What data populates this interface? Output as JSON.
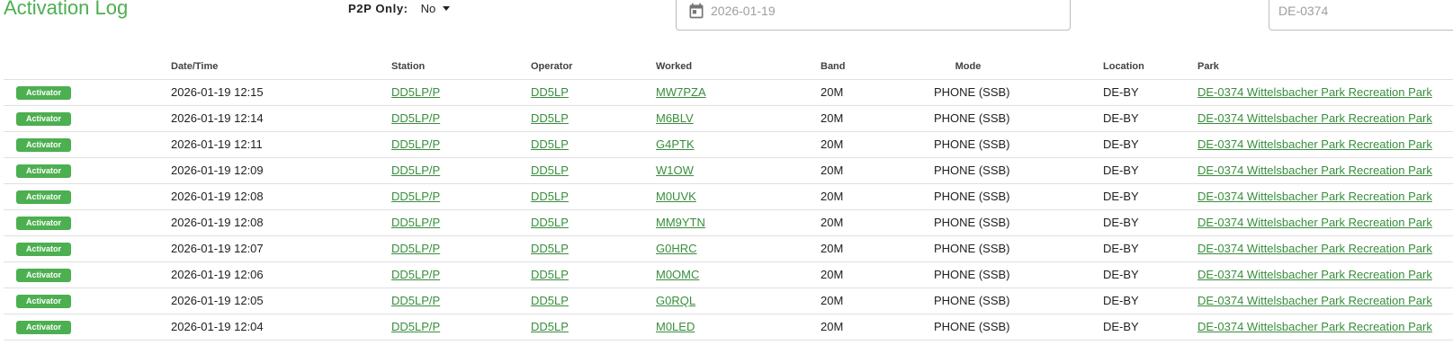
{
  "header": {
    "title": "Activation Log",
    "p2p_label": "P2P Only:",
    "p2p_value": "No",
    "date_placeholder": "2026-01-19",
    "park_placeholder": "DE-0374"
  },
  "table": {
    "columns": [
      "",
      "Date/Time",
      "Station",
      "Operator",
      "Worked",
      "Band",
      "Mode",
      "Location",
      "Park"
    ],
    "rows": [
      {
        "badge": "Activator",
        "datetime": "2026-01-19 12:15",
        "station": "DD5LP/P",
        "operator": "DD5LP",
        "worked": "MW7PZA",
        "band": "20M",
        "mode": "PHONE (SSB)",
        "location": "DE-BY",
        "park": "DE-0374 Wittelsbacher Park Recreation Park"
      },
      {
        "badge": "Activator",
        "datetime": "2026-01-19 12:14",
        "station": "DD5LP/P",
        "operator": "DD5LP",
        "worked": "M6BLV",
        "band": "20M",
        "mode": "PHONE (SSB)",
        "location": "DE-BY",
        "park": "DE-0374 Wittelsbacher Park Recreation Park"
      },
      {
        "badge": "Activator",
        "datetime": "2026-01-19 12:11",
        "station": "DD5LP/P",
        "operator": "DD5LP",
        "worked": "G4PTK",
        "band": "20M",
        "mode": "PHONE (SSB)",
        "location": "DE-BY",
        "park": "DE-0374 Wittelsbacher Park Recreation Park"
      },
      {
        "badge": "Activator",
        "datetime": "2026-01-19 12:09",
        "station": "DD5LP/P",
        "operator": "DD5LP",
        "worked": "W1OW",
        "band": "20M",
        "mode": "PHONE (SSB)",
        "location": "DE-BY",
        "park": "DE-0374 Wittelsbacher Park Recreation Park"
      },
      {
        "badge": "Activator",
        "datetime": "2026-01-19 12:08",
        "station": "DD5LP/P",
        "operator": "DD5LP",
        "worked": "M0UVK",
        "band": "20M",
        "mode": "PHONE (SSB)",
        "location": "DE-BY",
        "park": "DE-0374 Wittelsbacher Park Recreation Park"
      },
      {
        "badge": "Activator",
        "datetime": "2026-01-19 12:08",
        "station": "DD5LP/P",
        "operator": "DD5LP",
        "worked": "MM9YTN",
        "band": "20M",
        "mode": "PHONE (SSB)",
        "location": "DE-BY",
        "park": "DE-0374 Wittelsbacher Park Recreation Park"
      },
      {
        "badge": "Activator",
        "datetime": "2026-01-19 12:07",
        "station": "DD5LP/P",
        "operator": "DD5LP",
        "worked": "G0HRC",
        "band": "20M",
        "mode": "PHONE (SSB)",
        "location": "DE-BY",
        "park": "DE-0374 Wittelsbacher Park Recreation Park"
      },
      {
        "badge": "Activator",
        "datetime": "2026-01-19 12:06",
        "station": "DD5LP/P",
        "operator": "DD5LP",
        "worked": "M0OMC",
        "band": "20M",
        "mode": "PHONE (SSB)",
        "location": "DE-BY",
        "park": "DE-0374 Wittelsbacher Park Recreation Park"
      },
      {
        "badge": "Activator",
        "datetime": "2026-01-19 12:05",
        "station": "DD5LP/P",
        "operator": "DD5LP",
        "worked": "G0RQL",
        "band": "20M",
        "mode": "PHONE (SSB)",
        "location": "DE-BY",
        "park": "DE-0374 Wittelsbacher Park Recreation Park"
      },
      {
        "badge": "Activator",
        "datetime": "2026-01-19 12:04",
        "station": "DD5LP/P",
        "operator": "DD5LP",
        "worked": "M0LED",
        "band": "20M",
        "mode": "PHONE (SSB)",
        "location": "DE-BY",
        "park": "DE-0374 Wittelsbacher Park Recreation Park"
      }
    ]
  },
  "colors": {
    "accent": "#4caf50",
    "link": "#388e3c",
    "border": "#e0e0e0"
  },
  "icons": {
    "date_field": "calendar-icon",
    "p2p_dropdown": "caret-down-icon"
  }
}
